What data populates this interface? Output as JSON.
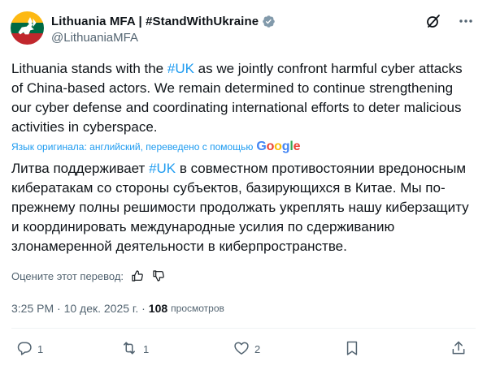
{
  "account": {
    "display_name": "Lithuania MFA | #StandWithUkraine",
    "handle": "@LithuaniaMFA"
  },
  "tweet": {
    "text_en_parts": [
      "Lithuania stands with the ",
      "#UK",
      " as we jointly confront harmful cyber attacks of China-based actors. We remain determined to continue strengthening our cyber defense and coordinating international efforts to deter malicious activities in cyberspace."
    ],
    "translation_note": "Язык оригинала: английский, переведено с помощью",
    "translation_provider": "Google",
    "text_ru_parts": [
      "Литва поддерживает ",
      "#UK",
      " в совместном противостоянии вредоносным кибератакам со стороны субъектов, базирующихся в Китае. Мы по-прежнему полны решимости продолжать укреплять нашу киберзащиту и координировать международные усилия по сдерживанию злонамеренной деятельности в киберпространстве."
    ],
    "rate_translation": "Оцените этот перевод:",
    "timestamp": "3:25 PM · 10 дек. 2025 г. ·",
    "views_count": "108",
    "views_label": "просмотров"
  },
  "actions": {
    "replies": "1",
    "reposts": "1",
    "likes": "2"
  },
  "colors": {
    "accent": "#1d9bf0",
    "secondary_text": "#536471",
    "verified_badge": "#829aab",
    "flag_yellow": "#fdb913",
    "flag_green": "#006a44",
    "flag_red": "#c1272d"
  },
  "icons": [
    "verified-badge-icon",
    "grok-icon",
    "more-options-icon",
    "thumbs-up-icon",
    "thumbs-down-icon",
    "reply-icon",
    "repost-icon",
    "like-icon",
    "bookmark-icon",
    "share-icon"
  ]
}
